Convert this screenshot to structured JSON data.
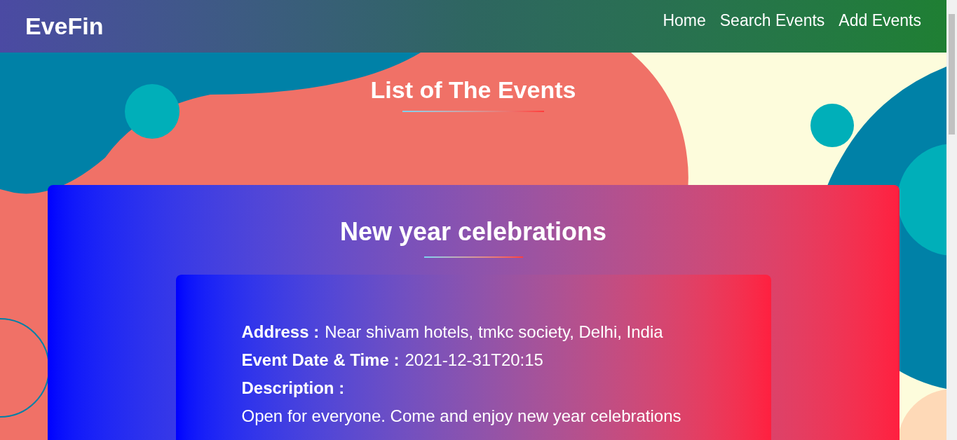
{
  "navbar": {
    "brand": "EveFin",
    "links": [
      {
        "label": "Home"
      },
      {
        "label": "Search Events"
      },
      {
        "label": "Add Events"
      }
    ]
  },
  "page_title": "List of The Events",
  "events": [
    {
      "title": "New year celebrations",
      "fields": [
        {
          "label": "Address :",
          "value": "Near shivam hotels, tmkc society, Delhi, India"
        },
        {
          "label": "Event Date & Time :",
          "value": "2021-12-31T20:15"
        },
        {
          "label": "Description :"
        }
      ],
      "description": "Open for everyone. Come and enjoy new year celebrations"
    }
  ]
}
